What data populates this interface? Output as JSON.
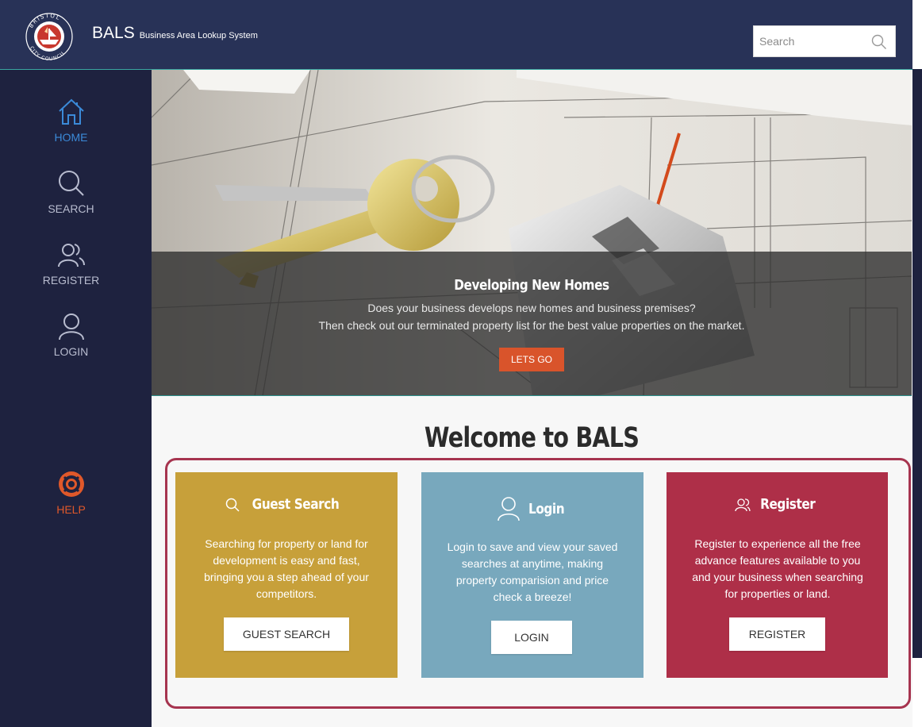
{
  "header": {
    "logo_text": "BRISTOL CITY COUNCIL",
    "app_name": "BALS",
    "app_full_name": "Business Area Lookup System",
    "search_placeholder": "Search"
  },
  "sidebar": {
    "items": [
      {
        "label": "HOME",
        "icon": "home-icon",
        "active": true
      },
      {
        "label": "SEARCH",
        "icon": "search-icon"
      },
      {
        "label": "REGISTER",
        "icon": "users-icon"
      },
      {
        "label": "LOGIN",
        "icon": "user-icon"
      },
      {
        "label": "HELP",
        "icon": "lifebuoy-icon"
      }
    ]
  },
  "hero": {
    "title": "Developing New Homes",
    "line1": "Does your business develops new homes and business premises?",
    "line2": "Then check out our terminated property list for the best value properties on the market.",
    "button": "LETS GO"
  },
  "welcome": {
    "title": "Welcome to BALS"
  },
  "cards": [
    {
      "title": "Guest Search",
      "icon": "search-icon",
      "text": "Searching for property or land for development is easy and fast, bringing you a step ahead of your competitors.",
      "button": "GUEST SEARCH",
      "color": "#c7a03a"
    },
    {
      "title": "Login",
      "icon": "user-icon",
      "text": "Login to save and view your saved searches at anytime, making property comparision and price check a breeze!",
      "button": "LOGIN",
      "color": "#78a8bd"
    },
    {
      "title": "Register",
      "icon": "users-icon",
      "text": "Register to experience all the free advance features available to you and your business when searching for properties or land.",
      "button": "REGISTER",
      "color": "#ae2f48"
    }
  ],
  "colors": {
    "header_bg": "#283257",
    "sidebar_bg": "#1e223f",
    "accent_orange": "#d9542b",
    "active_blue": "#3b8ad8",
    "frame_border": "#a6344f"
  }
}
